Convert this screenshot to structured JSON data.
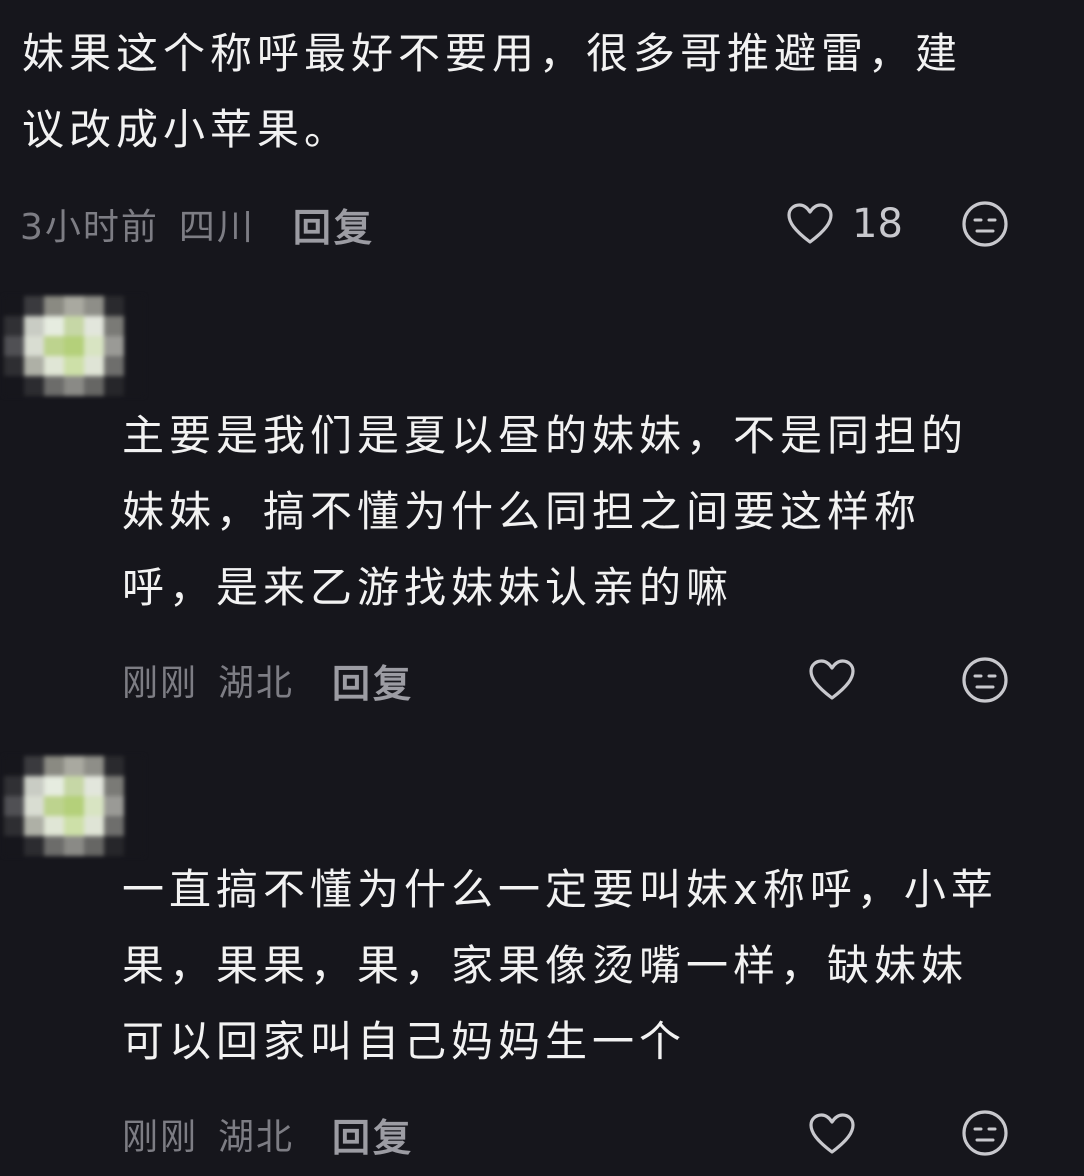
{
  "comments": [
    {
      "text": "妹果这个称呼最好不要用，很多哥推避雷，建\n议改成小苹果。",
      "time": "3小时前",
      "location": "四川",
      "reply_label": "回复",
      "like_count": "18"
    },
    {
      "text": "主要是我们是夏以昼的妹妹，不是同担的\n妹妹，搞不懂为什么同担之间要这样称\n呼，是来乙游找妹妹认亲的嘛",
      "time": "刚刚",
      "location": "湖北",
      "reply_label": "回复",
      "like_count": ""
    },
    {
      "text": "一直搞不懂为什么一定要叫妹x称呼，小苹\n果，果果，果，家果像烫嘴一样，缺妹妹\n可以回家叫自己妈妈生一个",
      "time": "刚刚",
      "location": "湖北",
      "reply_label": "回复",
      "like_count": ""
    }
  ],
  "icons": {
    "like": "heart-outline-icon",
    "reaction": "neutral-face-icon"
  },
  "colors": {
    "background": "#16161c",
    "text": "#f2f2f2",
    "meta": "#7d7d84",
    "icon": "#c8c8cd"
  }
}
